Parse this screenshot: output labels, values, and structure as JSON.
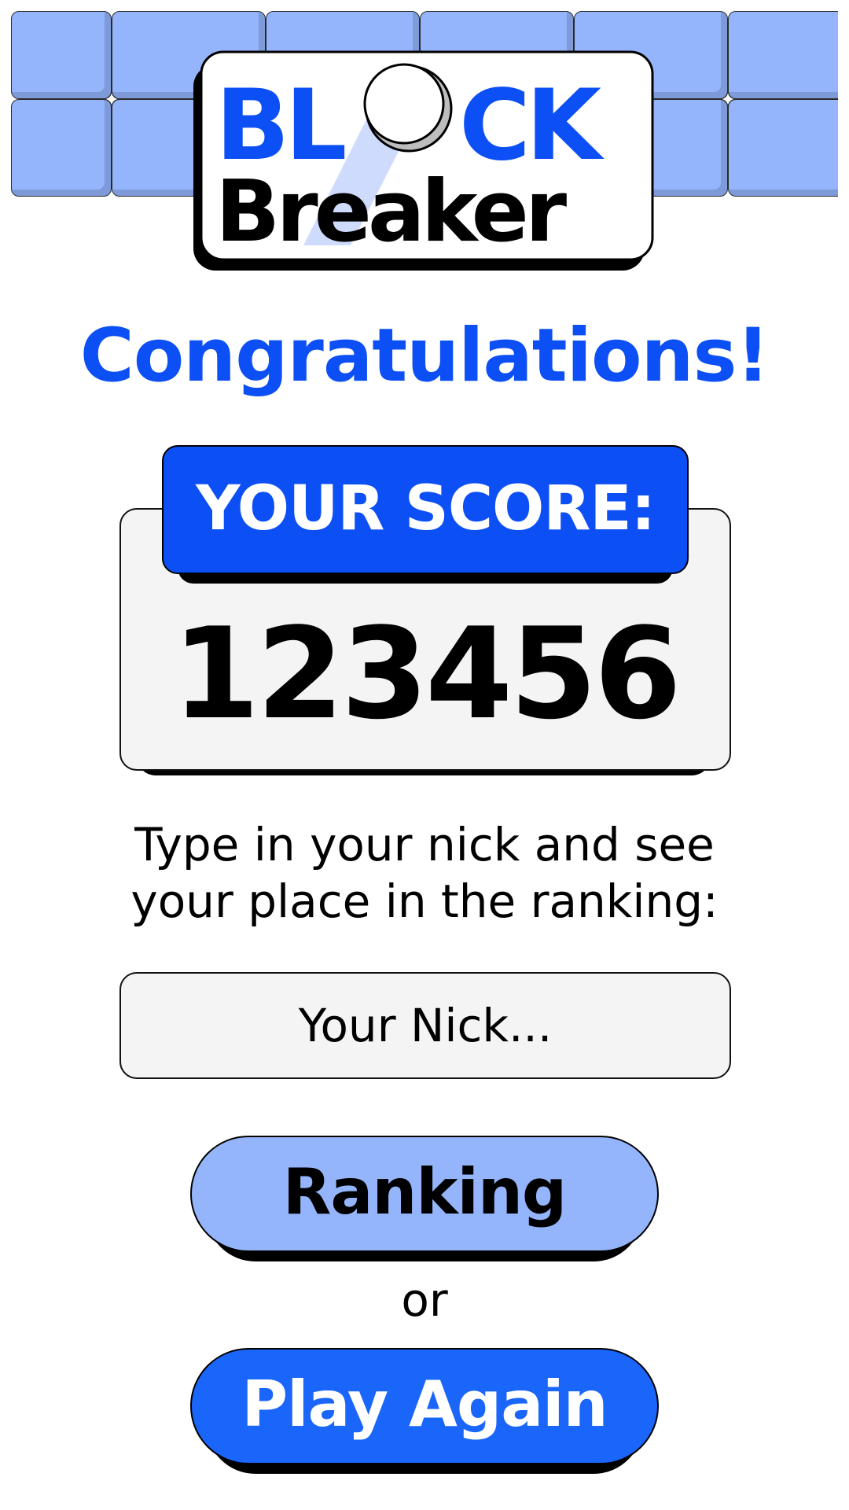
{
  "header": {
    "logo_line1_part1": "BL",
    "logo_line1_part2": "CK",
    "logo_line2": "Breaker"
  },
  "congrats": {
    "title": "Congratulations!"
  },
  "score": {
    "label": "YOUR SCORE:",
    "value": "123456"
  },
  "instructions": {
    "line1": "Type in your nick and see",
    "line2": "your place in the ranking:"
  },
  "nick_field": {
    "placeholder": "Your Nick...",
    "value": ""
  },
  "buttons": {
    "ranking_label": "Ranking",
    "or_label": "or",
    "play_again_label": "Play Again"
  },
  "colors": {
    "brand_blue": "#0b4ff5",
    "play_button_blue": "#1b66fa",
    "light_blue": "#94b5fb",
    "panel_gray": "#f4f4f4"
  },
  "icons": {
    "ball": "ball-icon",
    "sparkle": "sparkle-icon"
  }
}
